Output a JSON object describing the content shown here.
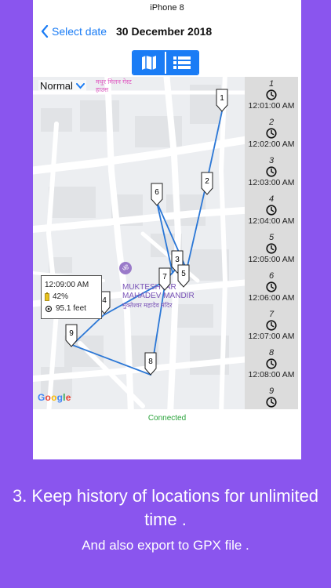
{
  "device": {
    "label": "iPhone 8"
  },
  "navbar": {
    "back_label": "Select date",
    "title": "30 December 2018"
  },
  "segmented": {
    "map_icon": "map-icon",
    "list_icon": "list-icon"
  },
  "map": {
    "type_label": "Normal",
    "poi_top": "मधुर मिलन गेस्ट हाउस",
    "poi_name": "MUKTESHVAR MAHADEV MANDIR",
    "poi_hindi": "मुक्तेश्वर महादेव मंदिर",
    "poi_symbol": "ॐ",
    "google_logo": "Google",
    "markers": [
      "1",
      "2",
      "3",
      "4",
      "5",
      "6",
      "7",
      "8",
      "9"
    ],
    "callout": {
      "time": "12:09:00 AM",
      "battery": "42%",
      "accuracy": "95.1 feet"
    }
  },
  "timeline": [
    {
      "num": "1",
      "time": "12:01:00 AM"
    },
    {
      "num": "2",
      "time": "12:02:00 AM"
    },
    {
      "num": "3",
      "time": "12:03:00 AM"
    },
    {
      "num": "4",
      "time": "12:04:00 AM"
    },
    {
      "num": "5",
      "time": "12:05:00 AM"
    },
    {
      "num": "6",
      "time": "12:06:00 AM"
    },
    {
      "num": "7",
      "time": "12:07:00 AM"
    },
    {
      "num": "8",
      "time": "12:08:00 AM"
    },
    {
      "num": "9",
      "time": ""
    }
  ],
  "status": "Connected",
  "caption": "3. Keep history of locations for unlimited time .",
  "subcaption": "And also export to GPX file .",
  "colors": {
    "background": "#8a55ee",
    "accent": "#1a7cf5",
    "route": "#2b77d6",
    "status": "#2aa33b"
  }
}
